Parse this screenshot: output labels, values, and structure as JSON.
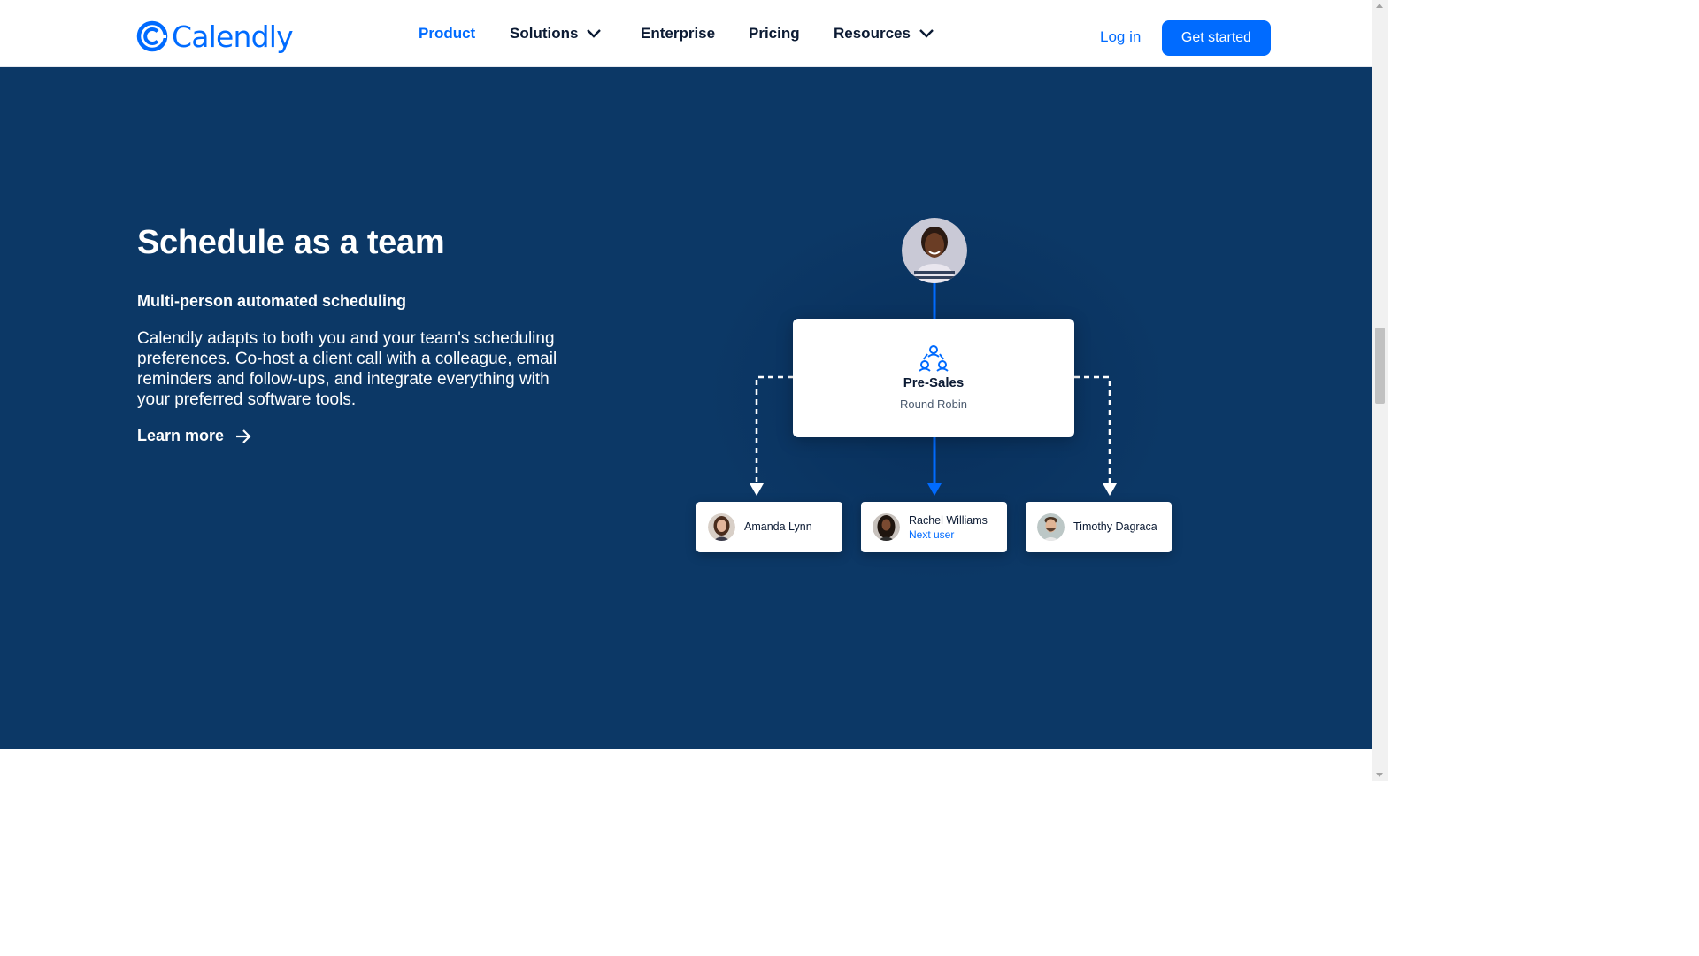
{
  "brand": {
    "name": "Calendly",
    "color": "#006bff",
    "logo_icon": "calendly-c-icon"
  },
  "nav": {
    "items": [
      {
        "label": "Product",
        "active": true
      },
      {
        "label": "Solutions",
        "dropdown": true
      },
      {
        "label": "Enterprise"
      },
      {
        "label": "Pricing"
      },
      {
        "label": "Resources",
        "dropdown": true
      }
    ],
    "login_label": "Log in",
    "cta_label": "Get started"
  },
  "hero": {
    "background": "#0c3866",
    "title": "Schedule as a team",
    "subtitle": "Multi-person automated scheduling",
    "body": "Calendly adapts to both you and your team's scheduling preferences. Co-host a client call with a colleague, email reminders and follow-ups, and integrate everything with your preferred software tools.",
    "link_label": "Learn more",
    "link_icon": "arrow-right-icon"
  },
  "diagram": {
    "group": {
      "name": "Pre-Sales",
      "type": "Round Robin",
      "icon": "team-icon"
    },
    "users": [
      {
        "name": "Amanda Lynn",
        "status": ""
      },
      {
        "name": "Rachel Williams",
        "status": "Next user"
      },
      {
        "name": "Timothy Dagraca",
        "status": ""
      }
    ]
  }
}
